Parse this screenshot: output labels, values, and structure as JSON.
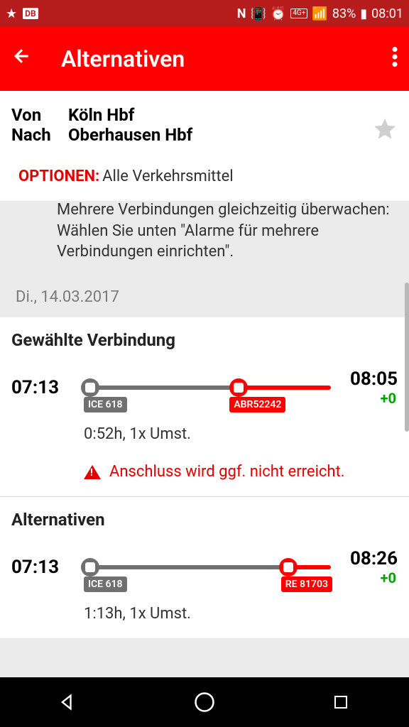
{
  "statusbar": {
    "db_badge": "DB",
    "sig4g": "4G+",
    "battery": "83%",
    "clock": "08:01"
  },
  "appbar": {
    "title": "Alternativen"
  },
  "route": {
    "from_label": "Von",
    "from_value": "Köln Hbf",
    "to_label": "Nach",
    "to_value": "Oberhausen Hbf"
  },
  "options": {
    "label": "OPTIONEN:",
    "value": "Alle Verkehrsmittel"
  },
  "infobox": {
    "text": "Mehrere Verbindungen gleichzeitig überwachen: Wählen Sie unten \"Alarme für mehrere Verbindungen einrichten\"."
  },
  "date_header": "Di., 14.03.2017",
  "section_selected_title": "Gewählte Verbindung",
  "section_alt_title": "Alternativen",
  "conn1": {
    "dep": "07:13",
    "arr": "08:05",
    "delta": "+0",
    "badge1": "ICE 618",
    "badge2": "ABR52242",
    "duration": "0:52h, 1x Umst.",
    "warning": "Anschluss wird ggf. nicht erreicht."
  },
  "conn2": {
    "dep": "07:13",
    "arr": "08:26",
    "delta": "+0",
    "badge1": "ICE 618",
    "badge2": "RE 81703",
    "duration": "1:13h, 1x Umst."
  }
}
